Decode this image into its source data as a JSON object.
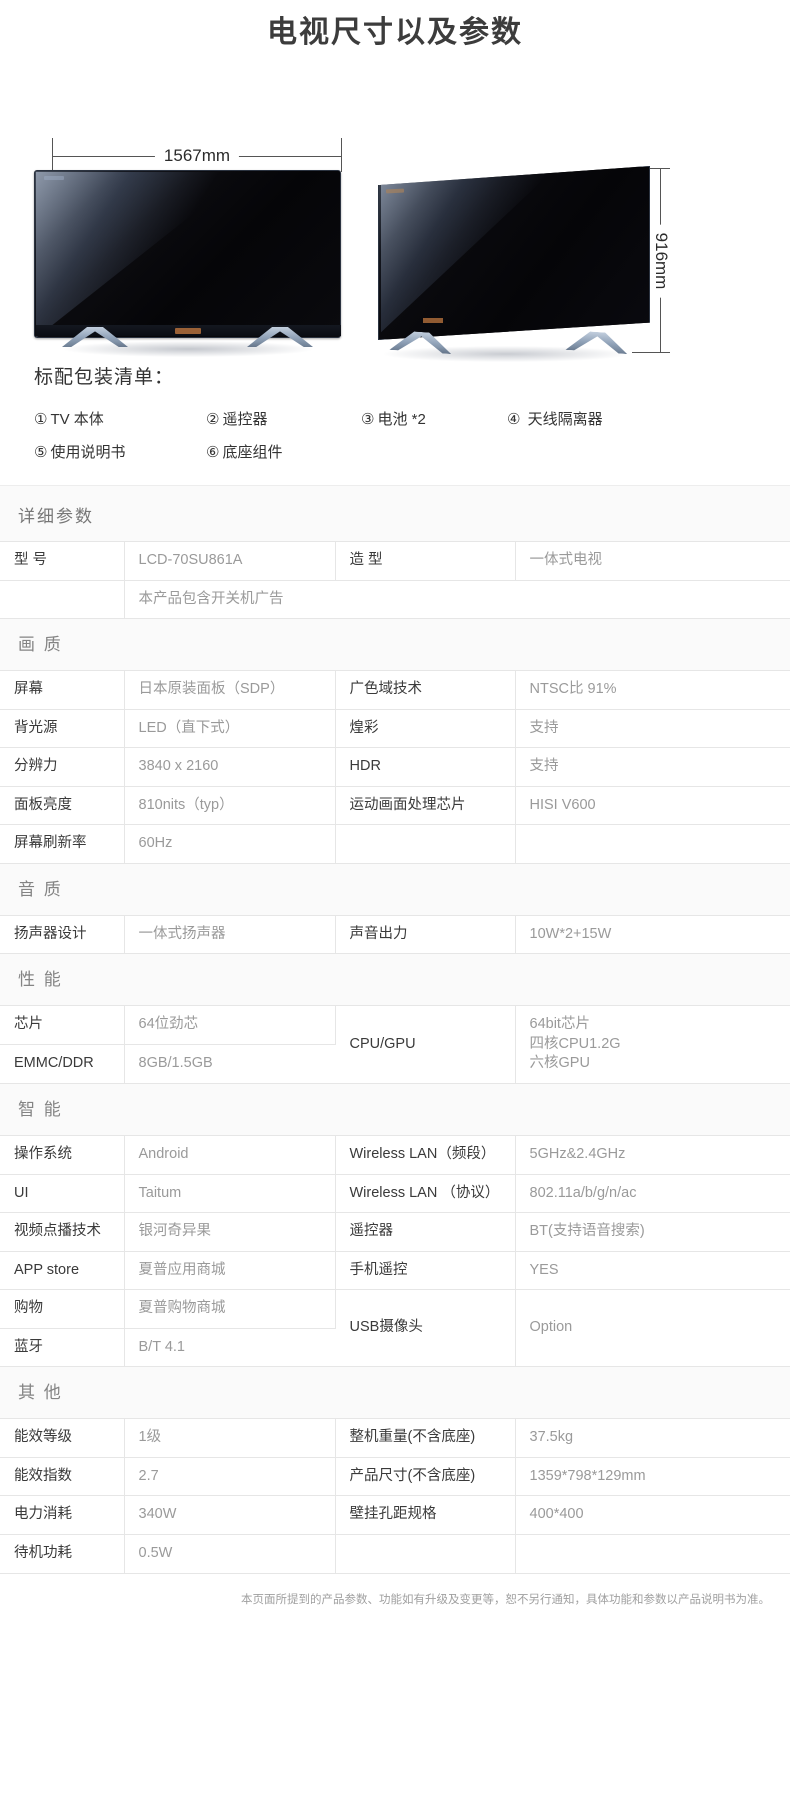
{
  "title": "电视尺寸以及参数",
  "diagram": {
    "width_label": "1567mm",
    "height_label": "916mm",
    "front_view_name": "tv-front-view",
    "angled_view_name": "tv-angled-view"
  },
  "packing": {
    "heading": "标配包装清单：",
    "rows": [
      [
        {
          "num": "①",
          "text": "TV 本体"
        },
        {
          "num": "②",
          "text": "遥控器"
        },
        {
          "num": "③",
          "text": "电池 *2"
        },
        {
          "num": "④",
          "text": "天线隔离器"
        }
      ],
      [
        {
          "num": "⑤",
          "text": "使用说明书"
        },
        {
          "num": "⑥",
          "text": "底座组件"
        }
      ]
    ]
  },
  "spec": {
    "heading": "详细参数",
    "rows": [
      {
        "type": "data",
        "cells": [
          {
            "t": "k",
            "v": "型 号"
          },
          {
            "t": "v",
            "v": "LCD-70SU861A"
          },
          {
            "t": "k",
            "v": "造 型"
          },
          {
            "t": "v",
            "v": "一体式电视"
          }
        ]
      },
      {
        "type": "data",
        "cells": [
          {
            "t": "k",
            "v": ""
          },
          {
            "t": "v",
            "v": "本产品包含开关机广告",
            "colspan": 3
          }
        ]
      },
      {
        "type": "section",
        "label": "画 质"
      },
      {
        "type": "data",
        "cells": [
          {
            "t": "k",
            "v": "屏幕"
          },
          {
            "t": "v",
            "v": "日本原装面板（SDP）"
          },
          {
            "t": "k",
            "v": "广色域技术"
          },
          {
            "t": "v",
            "v": "NTSC比 91%"
          }
        ]
      },
      {
        "type": "data",
        "cells": [
          {
            "t": "k",
            "v": "背光源"
          },
          {
            "t": "v",
            "v": "LED（直下式）"
          },
          {
            "t": "k",
            "v": "煌彩"
          },
          {
            "t": "v",
            "v": "支持"
          }
        ]
      },
      {
        "type": "data",
        "cells": [
          {
            "t": "k",
            "v": "分辨力"
          },
          {
            "t": "v",
            "v": "3840 x 2160"
          },
          {
            "t": "k",
            "v": "HDR"
          },
          {
            "t": "v",
            "v": "支持"
          }
        ]
      },
      {
        "type": "data",
        "cells": [
          {
            "t": "k",
            "v": "面板亮度"
          },
          {
            "t": "v",
            "v": "810nits（typ）"
          },
          {
            "t": "k",
            "v": "运动画面处理芯片"
          },
          {
            "t": "v",
            "v": "HISI V600"
          }
        ]
      },
      {
        "type": "data",
        "cells": [
          {
            "t": "k",
            "v": "屏幕刷新率"
          },
          {
            "t": "v",
            "v": "60Hz"
          },
          {
            "t": "k",
            "v": ""
          },
          {
            "t": "v",
            "v": ""
          }
        ]
      },
      {
        "type": "section",
        "label": "音 质"
      },
      {
        "type": "data",
        "cells": [
          {
            "t": "k",
            "v": "扬声器设计"
          },
          {
            "t": "v",
            "v": "一体式扬声器"
          },
          {
            "t": "k",
            "v": "声音出力"
          },
          {
            "t": "v",
            "v": "10W*2+15W"
          }
        ]
      },
      {
        "type": "section",
        "label": "性 能"
      },
      {
        "type": "data",
        "cells": [
          {
            "t": "k",
            "v": "芯片"
          },
          {
            "t": "v",
            "v": "64位劲芯"
          },
          {
            "t": "k",
            "v": "CPU/GPU",
            "rowspan": 2
          },
          {
            "t": "v",
            "v": "64bit芯片\n四核CPU1.2G\n六核GPU",
            "rowspan": 2,
            "multiline": true
          }
        ]
      },
      {
        "type": "data",
        "cells": [
          {
            "t": "k",
            "v": "EMMC/DDR"
          },
          {
            "t": "v",
            "v": "8GB/1.5GB"
          }
        ]
      },
      {
        "type": "section",
        "label": "智 能"
      },
      {
        "type": "data",
        "cells": [
          {
            "t": "k",
            "v": "操作系统"
          },
          {
            "t": "v",
            "v": "Android"
          },
          {
            "t": "k",
            "v": "Wireless LAN（频段）"
          },
          {
            "t": "v",
            "v": "5GHz&2.4GHz"
          }
        ]
      },
      {
        "type": "data",
        "cells": [
          {
            "t": "k",
            "v": "UI"
          },
          {
            "t": "v",
            "v": "Taitum"
          },
          {
            "t": "k",
            "v": "Wireless LAN （协议）"
          },
          {
            "t": "v",
            "v": "802.11a/b/g/n/ac"
          }
        ]
      },
      {
        "type": "data",
        "cells": [
          {
            "t": "k",
            "v": "视频点播技术"
          },
          {
            "t": "v",
            "v": "银河奇异果"
          },
          {
            "t": "k",
            "v": "遥控器"
          },
          {
            "t": "v",
            "v": "BT(支持语音搜索)"
          }
        ]
      },
      {
        "type": "data",
        "cells": [
          {
            "t": "k",
            "v": "APP store"
          },
          {
            "t": "v",
            "v": "夏普应用商城"
          },
          {
            "t": "k",
            "v": "手机遥控"
          },
          {
            "t": "v",
            "v": "YES"
          }
        ]
      },
      {
        "type": "data",
        "cells": [
          {
            "t": "k",
            "v": "购物"
          },
          {
            "t": "v",
            "v": "夏普购物商城"
          },
          {
            "t": "k",
            "v": "USB摄像头",
            "rowspan": 2
          },
          {
            "t": "v",
            "v": "Option",
            "rowspan": 2
          }
        ]
      },
      {
        "type": "data",
        "cells": [
          {
            "t": "k",
            "v": "蓝牙"
          },
          {
            "t": "v",
            "v": "B/T 4.1"
          }
        ]
      },
      {
        "type": "section",
        "label": "其 他"
      },
      {
        "type": "data",
        "cells": [
          {
            "t": "k",
            "v": "能效等级"
          },
          {
            "t": "v",
            "v": "1级"
          },
          {
            "t": "k",
            "v": "整机重量(不含底座)"
          },
          {
            "t": "v",
            "v": "37.5kg"
          }
        ]
      },
      {
        "type": "data",
        "cells": [
          {
            "t": "k",
            "v": "能效指数"
          },
          {
            "t": "v",
            "v": "2.7"
          },
          {
            "t": "k",
            "v": "产品尺寸(不含底座)"
          },
          {
            "t": "v",
            "v": "1359*798*129mm"
          }
        ]
      },
      {
        "type": "data",
        "cells": [
          {
            "t": "k",
            "v": "电力消耗"
          },
          {
            "t": "v",
            "v": "340W"
          },
          {
            "t": "k",
            "v": "壁挂孔距规格"
          },
          {
            "t": "v",
            "v": "400*400"
          }
        ]
      },
      {
        "type": "data",
        "cells": [
          {
            "t": "k",
            "v": "待机功耗"
          },
          {
            "t": "v",
            "v": "0.5W"
          },
          {
            "t": "k",
            "v": ""
          },
          {
            "t": "v",
            "v": ""
          }
        ]
      }
    ]
  },
  "footnote": "本页面所提到的产品参数、功能如有升级及变更等，恕不另行通知，具体功能和参数以产品说明书为准。"
}
